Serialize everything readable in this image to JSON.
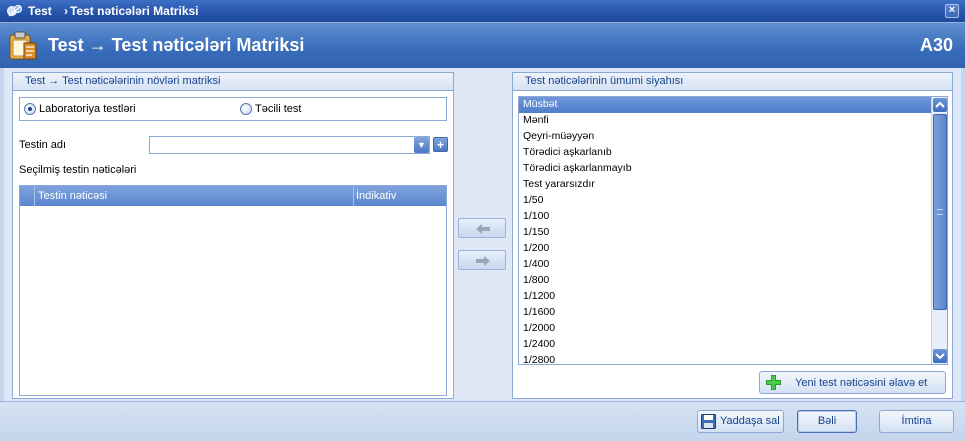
{
  "window": {
    "app_name": "Test",
    "separator": "›",
    "title": "Test nəticələri Matriksi",
    "close_glyph": "×"
  },
  "header": {
    "title": "Test → Test nəticələri Matriksi",
    "code": "A30",
    "icon": "clipboard-icon"
  },
  "left_panel": {
    "title": "Test → Test nəticələrinin növləri matriksi",
    "radios": [
      {
        "label": "Laboratoriya testləri",
        "checked": true
      },
      {
        "label": "Təcili test",
        "checked": false
      }
    ],
    "test_name_label": "Testin adı",
    "test_name_value": "",
    "selected_results_label": "Seçilmiş testin nəticələri",
    "grid": {
      "columns": [
        "Testin nəticəsi",
        "İndikativ"
      ],
      "rows": []
    }
  },
  "move_buttons": {
    "left_icon": "arrow-left-icon",
    "right_icon": "arrow-right-icon"
  },
  "right_panel": {
    "title": "Test nəticələrinin ümumi siyahısı",
    "items": [
      "Müsbət",
      "Mənfi",
      "Qeyri-müəyyən",
      "Törədici aşkarlanıb",
      "Törədici aşkarlanmayıb",
      "Test yararsızdır",
      "1/50",
      "1/100",
      "1/150",
      "1/200",
      "1/400",
      "1/800",
      "1/1200",
      "1/1600",
      "1/2000",
      "1/2400",
      "1/2800"
    ],
    "selected_index": 0,
    "add_button_label": "Yeni test nəticəsini əlavə et"
  },
  "footer": {
    "save_label": "Yaddaşa sal",
    "ok_label": "Bəli",
    "cancel_label": "İmtina"
  },
  "colors": {
    "title_bar": "#2553a8",
    "header": "#3a6ebc",
    "selection": "#4f7ec9",
    "panel_border": "#8ca8d4"
  }
}
